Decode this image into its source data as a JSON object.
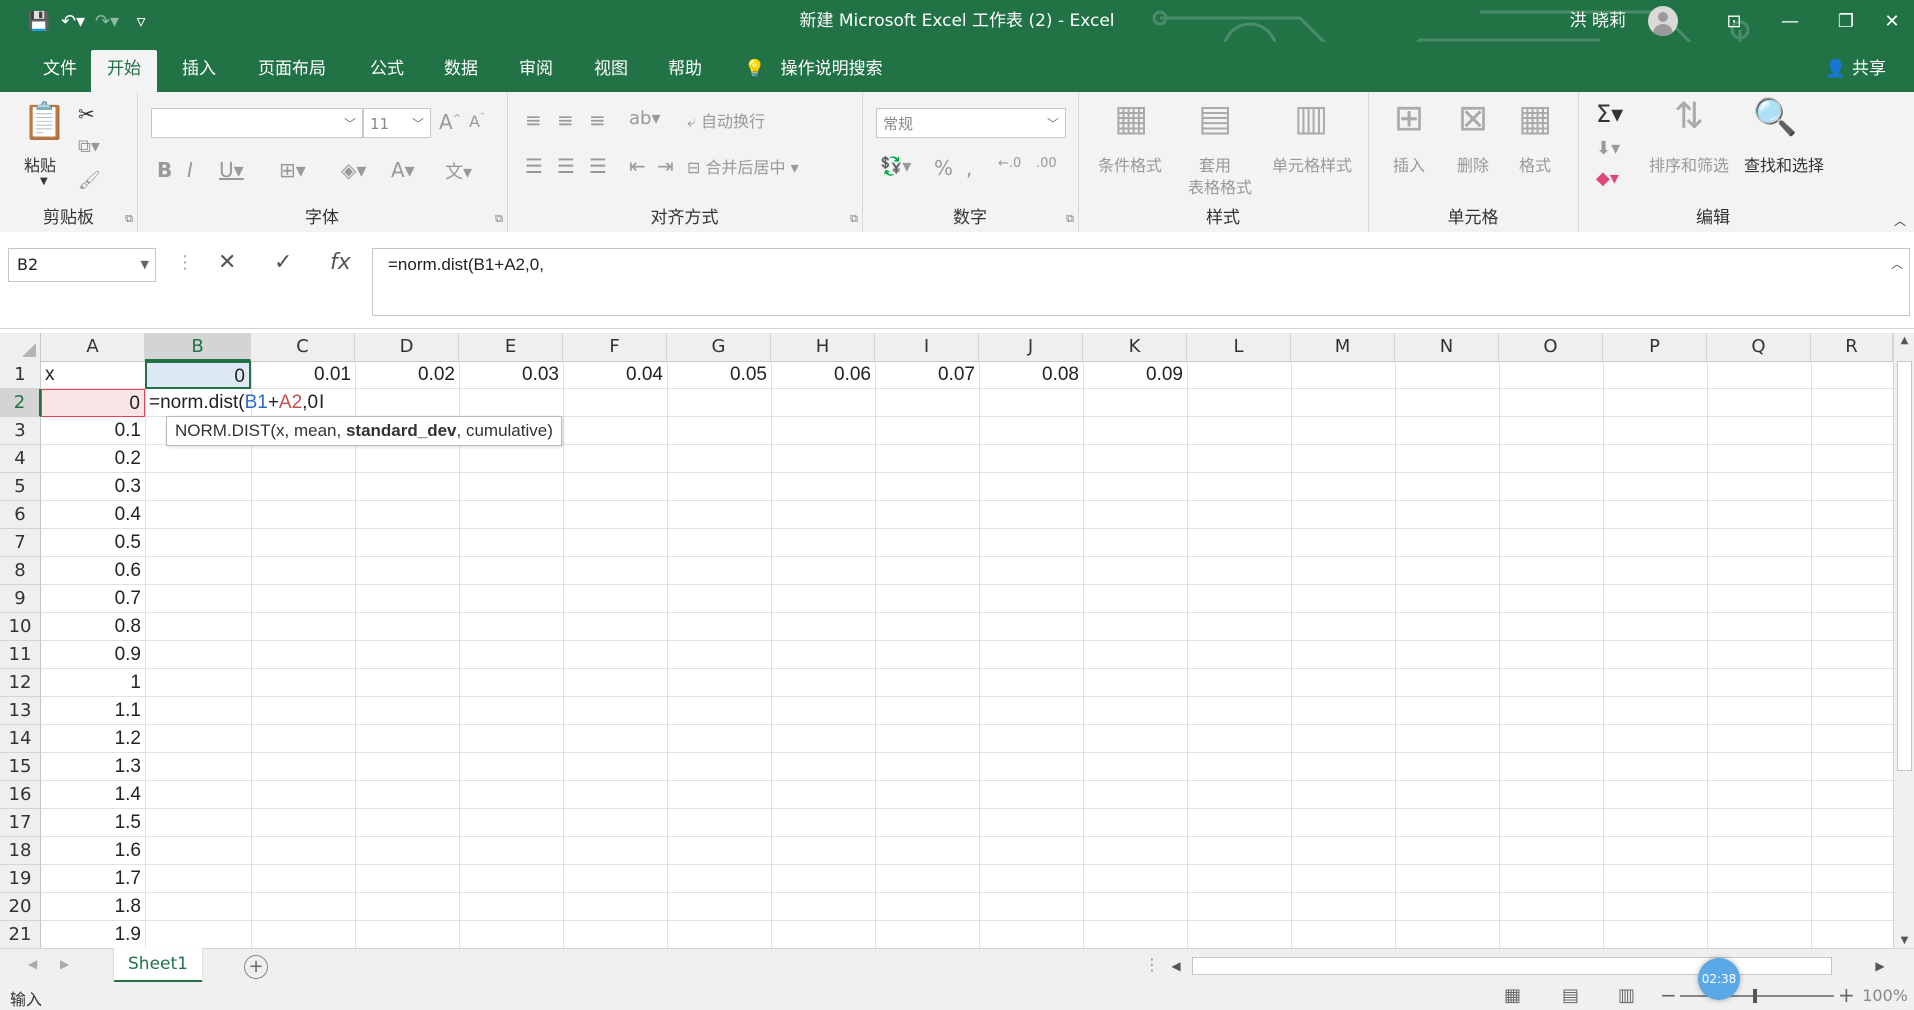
{
  "title": {
    "window_title": "新建 Microsoft Excel 工作表 (2)  -  Excel",
    "user": "洪 晓莉",
    "accent": "#217346"
  },
  "menu": {
    "tabs": [
      "文件",
      "开始",
      "插入",
      "页面布局",
      "公式",
      "数据",
      "审阅",
      "视图",
      "帮助"
    ],
    "active": "开始",
    "tell_me": "操作说明搜索",
    "share": "共享"
  },
  "ribbon": {
    "clipboard": {
      "label": "剪贴板",
      "paste": "粘贴"
    },
    "font": {
      "label": "字体",
      "size": "11"
    },
    "alignment": {
      "label": "对齐方式",
      "wrap": "自动换行",
      "merge": "合并后居中"
    },
    "number": {
      "label": "数字",
      "format": "常规"
    },
    "styles": {
      "label": "样式",
      "conditional": "条件格式",
      "table_format_1": "套用",
      "table_format_2": "表格格式",
      "cell_styles": "单元格样式"
    },
    "cells": {
      "label": "单元格",
      "insert": "插入",
      "delete": "删除",
      "format": "格式"
    },
    "editing": {
      "label": "编辑",
      "sort": "排序和筛选",
      "find": "查找和选择"
    }
  },
  "formula_bar": {
    "name_box": "B2",
    "formula": "=norm.dist(B1+A2,0,"
  },
  "grid": {
    "columns": [
      "A",
      "B",
      "C",
      "D",
      "E",
      "F",
      "G",
      "H",
      "I",
      "J",
      "K",
      "L",
      "M",
      "N",
      "O",
      "P",
      "Q",
      "R"
    ],
    "rows": [
      "1",
      "2",
      "3",
      "4",
      "5",
      "6",
      "7",
      "8",
      "9",
      "10",
      "11",
      "12",
      "13",
      "14",
      "15",
      "16",
      "17",
      "18",
      "19",
      "20",
      "21"
    ],
    "row1": [
      "x",
      "0",
      "0.01",
      "0.02",
      "0.03",
      "0.04",
      "0.05",
      "0.06",
      "0.07",
      "0.08",
      "0.09"
    ],
    "colA": [
      "0",
      "0.1",
      "0.2",
      "0.3",
      "0.4",
      "0.5",
      "0.6",
      "0.7",
      "0.8",
      "0.9",
      "1",
      "1.1",
      "1.2",
      "1.3",
      "1.4",
      "1.5",
      "1.6",
      "1.7",
      "1.8",
      "1.9"
    ],
    "editing_cell": {
      "prefix": "=norm.dist(",
      "ref1": "B1",
      "plus": "+",
      "ref2": "A2",
      "suffix": ",0"
    },
    "tooltip": {
      "before": "NORM.DIST(x, mean, ",
      "bold": "standard_dev",
      "after": ", cumulative)"
    }
  },
  "sheets": {
    "tab": "Sheet1"
  },
  "status": {
    "mode": "输入",
    "zoom": "100%",
    "timer": "02:38"
  }
}
